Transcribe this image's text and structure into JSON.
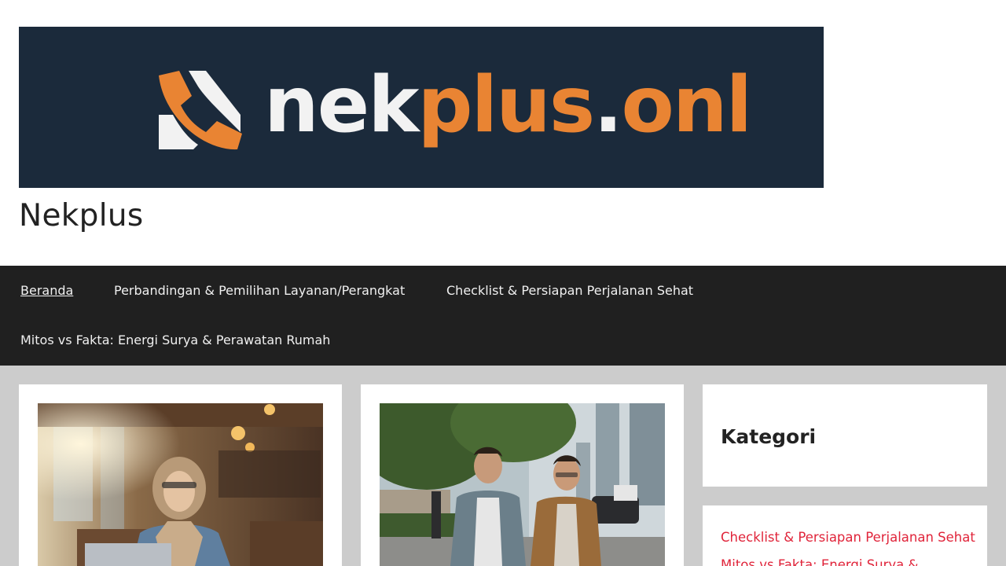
{
  "header": {
    "logo_text_white_1": "nek",
    "logo_text_orange_1": "plus",
    "logo_text_white_2": ".",
    "logo_text_orange_2": "onl",
    "site_title": "Nekplus"
  },
  "nav": {
    "items": [
      {
        "label": "Beranda",
        "active": true
      },
      {
        "label": "Perbandingan & Pemilihan Layanan/Perangkat",
        "active": false
      },
      {
        "label": "Checklist & Persiapan Perjalanan Sehat",
        "active": false
      },
      {
        "label": "Mitos vs Fakta: Energi Surya & Perawatan Rumah",
        "active": false
      }
    ]
  },
  "sidebar": {
    "widget_title": "Kategori",
    "categories": [
      "Checklist & Persiapan Perjalanan Sehat",
      "Mitos vs Fakta: Energi Surya &"
    ]
  },
  "colors": {
    "banner_bg": "#1b2a3b",
    "brand_orange": "#e98433",
    "nav_bg": "#202020",
    "link_red": "#e0243a",
    "page_bg": "#cccccc"
  }
}
